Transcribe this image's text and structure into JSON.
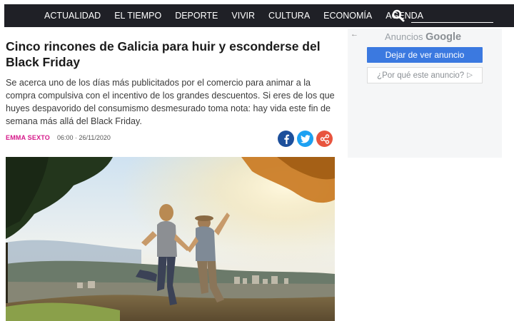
{
  "nav": {
    "items": [
      "ACTUALIDAD",
      "EL TIEMPO",
      "DEPORTE",
      "VIVIR",
      "CULTURA",
      "ECONOMÍA",
      "AGENDA"
    ],
    "search_value": ""
  },
  "article": {
    "headline": "Cinco rincones de Galicia para huir y esconderse del Black Friday",
    "lede": "Se acerca uno de los días más publicitados por el comercio para animar a la compra compulsiva con el incentivo de los grandes descuentos. Si eres de los que huyes despavorido del consumismo desmesurado toma nota: hay vida este fin de semana más allá del Black Friday.",
    "author": "EMMA SEXTO",
    "date": "06:00 · 26/11/2020",
    "social_icons": [
      "facebook-icon",
      "twitter-icon",
      "share-icon"
    ]
  },
  "ad": {
    "back_arrow": "←",
    "label_prefix": "Anuncios",
    "label_brand": "Google",
    "stop_button": "Dejar de ver anuncio",
    "why_button": "¿Por qué este anuncio?",
    "why_icon": "▷"
  },
  "colors": {
    "nav_bg": "#1f2026",
    "author": "#d6188a",
    "facebook": "#1d4f9b",
    "twitter": "#1da1f2",
    "share": "#e8543e",
    "ad_button": "#3b79e0"
  }
}
